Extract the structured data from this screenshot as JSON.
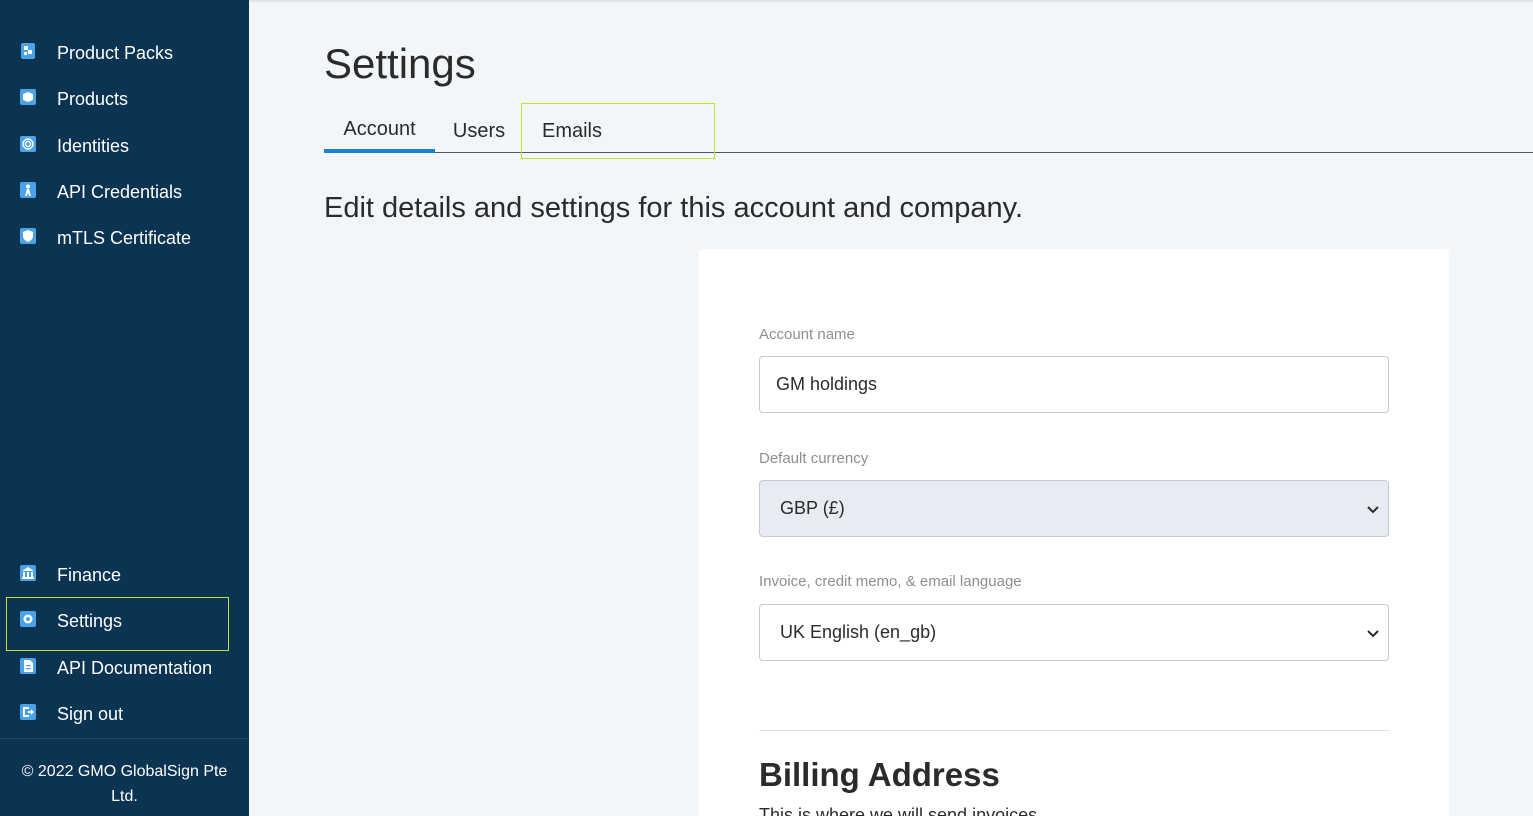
{
  "sidebar": {
    "top_items": [
      {
        "label": "Product Packs",
        "icon": "package-icon"
      },
      {
        "label": "Products",
        "icon": "box-icon"
      },
      {
        "label": "Identities",
        "icon": "fingerprint-icon"
      },
      {
        "label": "API Credentials",
        "icon": "key-person-icon"
      },
      {
        "label": "mTLS Certificate",
        "icon": "shield-icon"
      }
    ],
    "bottom_items": [
      {
        "label": "Finance",
        "icon": "bank-icon"
      },
      {
        "label": "Settings",
        "icon": "gear-icon"
      },
      {
        "label": "API Documentation",
        "icon": "document-icon"
      },
      {
        "label": "Sign out",
        "icon": "sign-out-icon"
      }
    ],
    "copyright": "© 2022 GMO GlobalSign Pte Ltd."
  },
  "main": {
    "title": "Settings",
    "tabs": [
      {
        "label": "Account",
        "active": true
      },
      {
        "label": "Users",
        "active": false
      },
      {
        "label": "Emails",
        "active": false
      }
    ],
    "subtitle": "Edit details and settings for this account and company.",
    "form": {
      "account_name_label": "Account name",
      "account_name_value": "GM holdings",
      "currency_label": "Default currency",
      "currency_value": "GBP (£)",
      "language_label": "Invoice, credit memo, & email language",
      "language_value": "UK English (en_gb)"
    },
    "billing": {
      "title": "Billing Address",
      "description": "This is where we will send invoices."
    }
  },
  "colors": {
    "sidebar_bg": "#0b3352",
    "accent": "#1a82d6",
    "highlight_box": "#c4e32a",
    "page_bg": "#f2f6f8"
  }
}
